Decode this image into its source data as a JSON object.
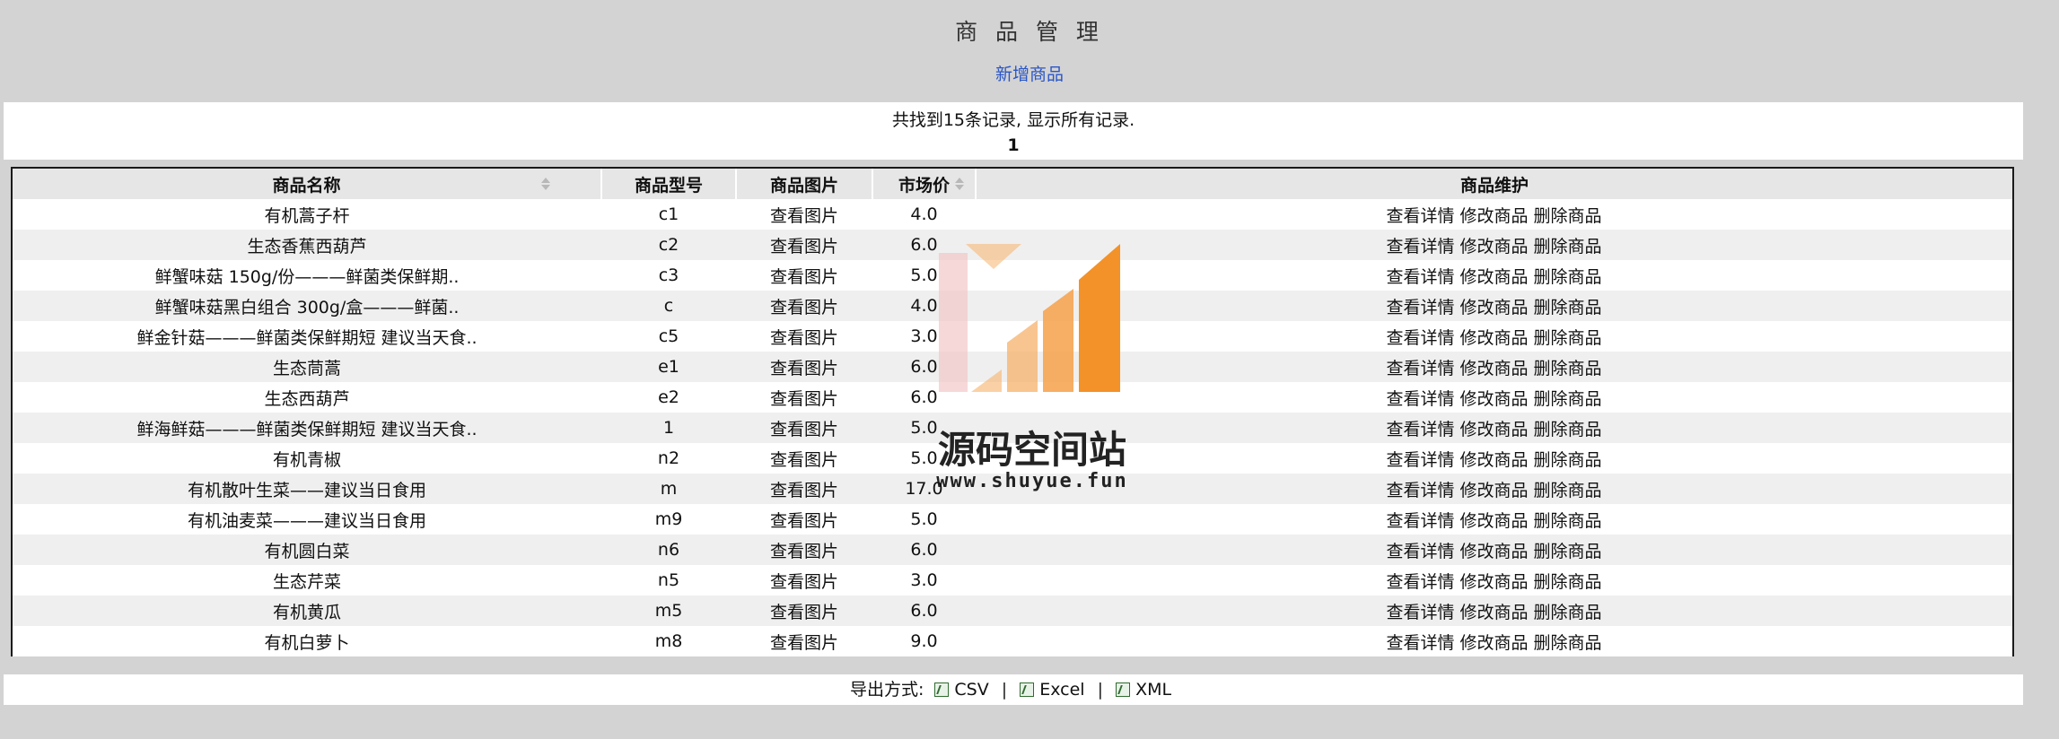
{
  "page": {
    "title": "商 品 管 理",
    "add_link": "新增商品",
    "summary": "共找到15条记录, 显示所有记录.",
    "page_number": "1"
  },
  "table": {
    "headers": [
      "商品名称",
      "商品型号",
      "商品图片",
      "市场价",
      "商品维护"
    ],
    "rows": [
      {
        "name": "有机蒿子杆",
        "model": "c1",
        "image": "查看图片",
        "price": "4.0"
      },
      {
        "name": "生态香蕉西葫芦",
        "model": "c2",
        "image": "查看图片",
        "price": "6.0"
      },
      {
        "name": "鲜蟹味菇 150g/份———鲜菌类保鲜期..",
        "model": "c3",
        "image": "查看图片",
        "price": "5.0"
      },
      {
        "name": "鲜蟹味菇黑白组合 300g/盒———鲜菌..",
        "model": "c",
        "image": "查看图片",
        "price": "4.0"
      },
      {
        "name": "鲜金针菇———鲜菌类保鲜期短 建议当天食..",
        "model": "c5",
        "image": "查看图片",
        "price": "3.0"
      },
      {
        "name": "生态茼蒿",
        "model": "e1",
        "image": "查看图片",
        "price": "6.0"
      },
      {
        "name": "生态西葫芦",
        "model": "e2",
        "image": "查看图片",
        "price": "6.0"
      },
      {
        "name": "鲜海鲜菇———鲜菌类保鲜期短 建议当天食..",
        "model": "1",
        "image": "查看图片",
        "price": "5.0"
      },
      {
        "name": "有机青椒",
        "model": "n2",
        "image": "查看图片",
        "price": "5.0"
      },
      {
        "name": "有机散叶生菜——建议当日食用",
        "model": "m",
        "image": "查看图片",
        "price": "17.0"
      },
      {
        "name": "有机油麦菜———建议当日食用",
        "model": "m9",
        "image": "查看图片",
        "price": "5.0"
      },
      {
        "name": "有机圆白菜",
        "model": "n6",
        "image": "查看图片",
        "price": "6.0"
      },
      {
        "name": "生态芹菜",
        "model": "n5",
        "image": "查看图片",
        "price": "3.0"
      },
      {
        "name": "有机黄瓜",
        "model": "m5",
        "image": "查看图片",
        "price": "6.0"
      },
      {
        "name": "有机白萝卜",
        "model": "m8",
        "image": "查看图片",
        "price": "9.0"
      }
    ],
    "actions": [
      "查看详情",
      "修改商品",
      "删除商品"
    ]
  },
  "export": {
    "label": "导出方式:",
    "options": [
      "CSV",
      "Excel",
      "XML"
    ]
  },
  "watermark": {
    "text": "源码空间站",
    "url": "www.shuyue.fun",
    "colors": {
      "orange": "#f28c1e",
      "light_orange": "#f6b26b",
      "pink": "#f2c7c7"
    }
  },
  "colors": {
    "background": "#d3d3d3",
    "link": "#2a56c6",
    "header_bg": "#e6e6e6",
    "row_alt": "#efefef"
  }
}
